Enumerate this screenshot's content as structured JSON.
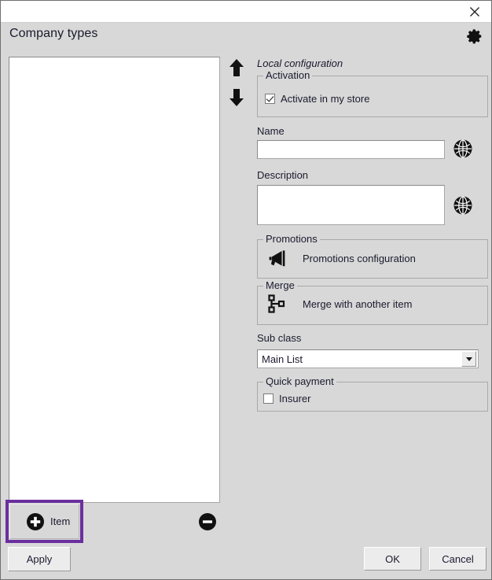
{
  "window": {
    "title_bar": {
      "close_label": "close-icon"
    },
    "page_title": "Company types",
    "settings_icon": "gear-icon"
  },
  "list_panel": {
    "items": [],
    "move_up_icon": "arrow-up-icon",
    "move_down_icon": "arrow-down-icon",
    "remove_icon": "minus-circle-icon",
    "add_button": {
      "label": "Item",
      "icon": "plus-circle-icon"
    },
    "apply_button": "Apply"
  },
  "config_panel": {
    "section_label": "Local configuration",
    "activation": {
      "legend": "Activation",
      "checkbox_label": "Activate in my store",
      "checked": true
    },
    "name": {
      "label": "Name",
      "value": "",
      "placeholder": "",
      "translate_icon": "globe-icon"
    },
    "description": {
      "label": "Description",
      "value": "",
      "placeholder": "",
      "translate_icon": "globe-icon"
    },
    "promotions": {
      "legend": "Promotions",
      "action_label": "Promotions configuration",
      "icon": "megaphone-icon"
    },
    "merge": {
      "legend": "Merge",
      "action_label": "Merge with another item",
      "icon": "merge-branch-icon"
    },
    "sub_class": {
      "label": "Sub class",
      "selected": "Main List",
      "options": [
        "Main List"
      ]
    },
    "quick_payment": {
      "legend": "Quick payment",
      "checkbox_label": "Insurer",
      "checked": false
    }
  },
  "footer": {
    "ok_label": "OK",
    "cancel_label": "Cancel"
  },
  "colors": {
    "window_bg": "#d8d8d8",
    "highlight": "#6b2f9e",
    "field_bg": "#ffffff",
    "text": "#1a1a2e"
  }
}
